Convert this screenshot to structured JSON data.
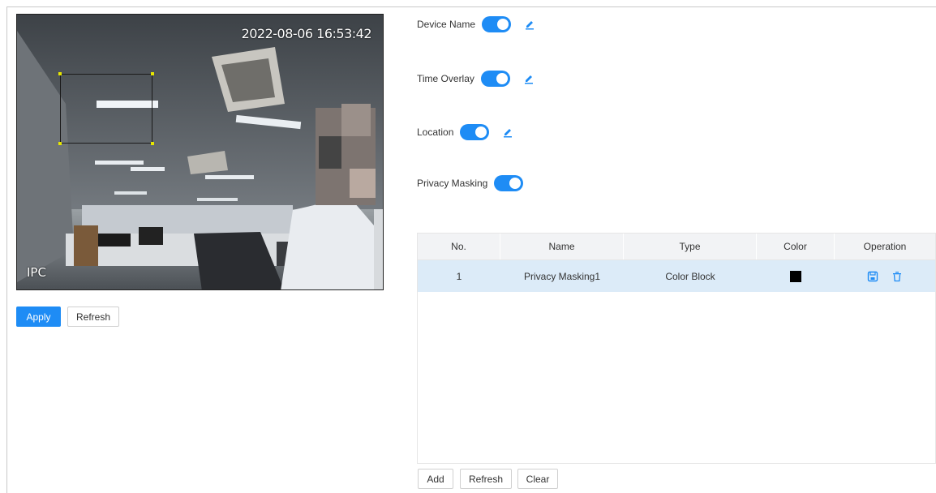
{
  "video": {
    "timestamp": "2022-08-06 16:53:42",
    "channel": "IPC"
  },
  "buttons": {
    "apply": "Apply",
    "refresh": "Refresh",
    "add": "Add",
    "table_refresh": "Refresh",
    "clear": "Clear"
  },
  "overlays": [
    {
      "label": "Device Name",
      "enabled": true,
      "editable": true
    },
    {
      "label": "Time Overlay",
      "enabled": true,
      "editable": true
    },
    {
      "label": "Location",
      "enabled": true,
      "editable": true
    },
    {
      "label": "Privacy Masking",
      "enabled": true,
      "editable": false
    }
  ],
  "table": {
    "headers": [
      "No.",
      "Name",
      "Type",
      "Color",
      "Operation"
    ],
    "rows": [
      {
        "no": "1",
        "name": "Privacy Masking1",
        "type": "Color Block",
        "color": "#000000"
      }
    ]
  },
  "colors": {
    "accent": "#1e8cf5",
    "selected_row": "#dcebf8",
    "header_bg": "#f2f3f5"
  },
  "icons": {
    "edit": "pencil-icon",
    "save": "save-icon",
    "delete": "trash-icon"
  }
}
